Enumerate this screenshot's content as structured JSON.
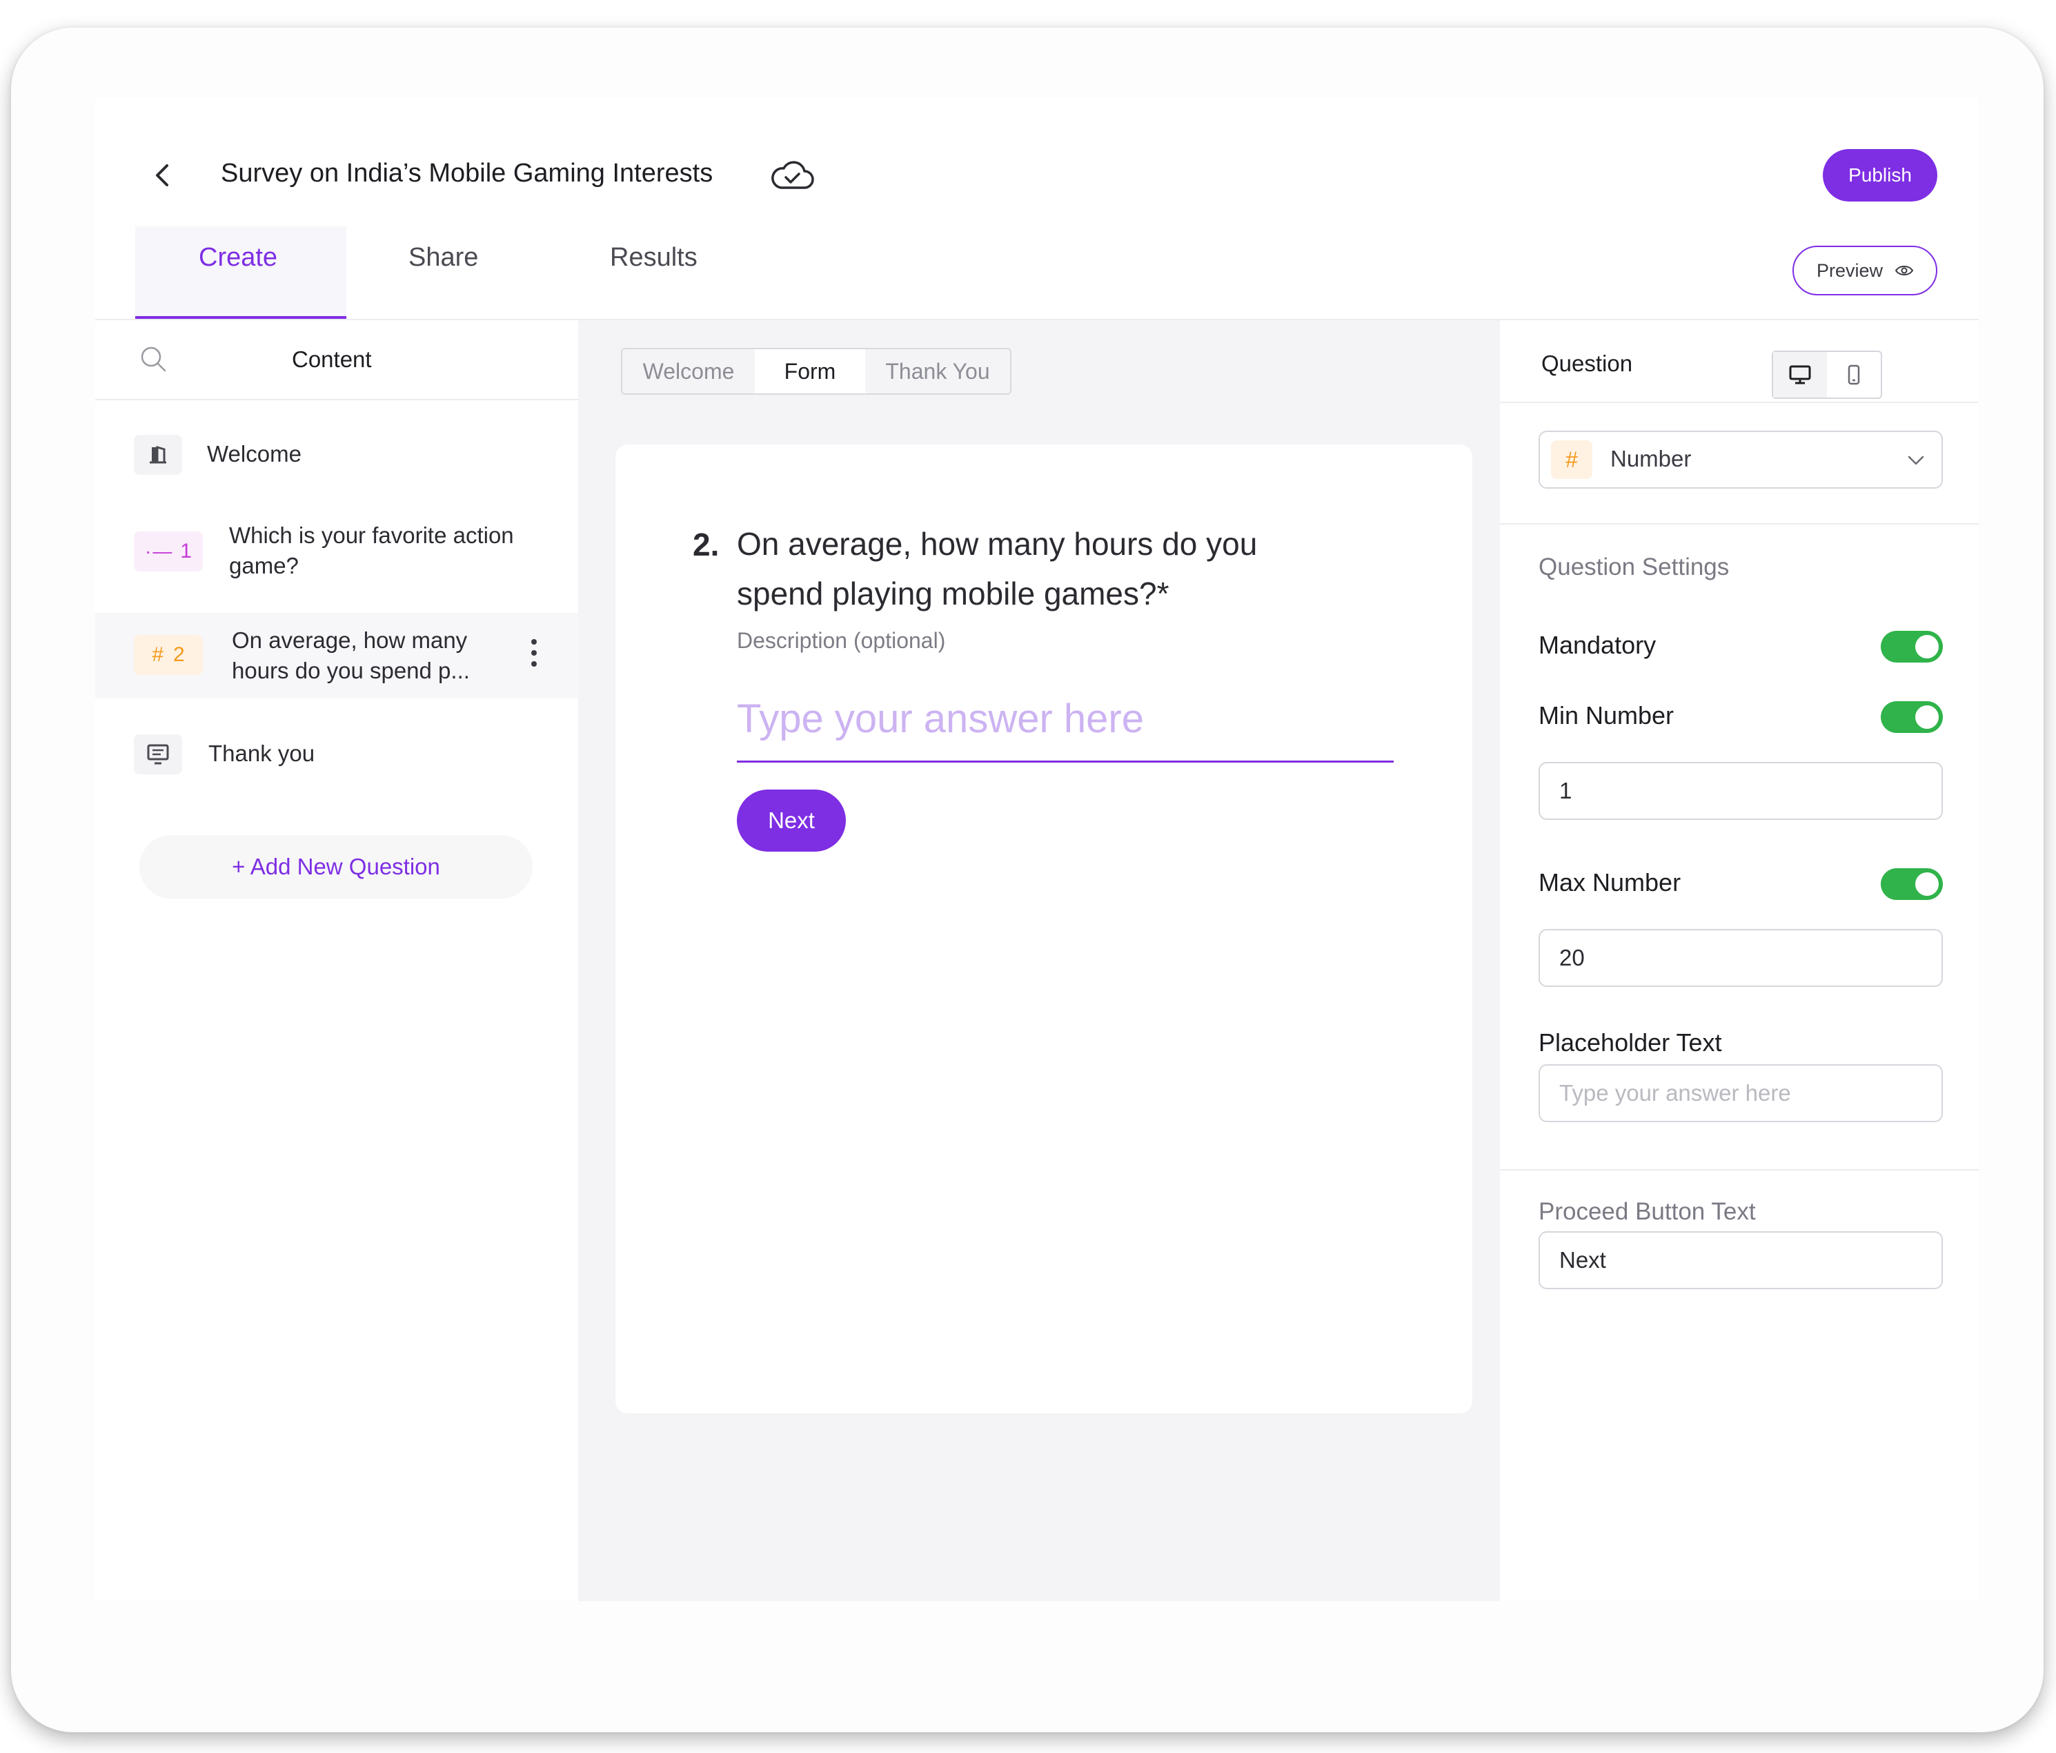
{
  "header": {
    "title": "Survey on India’s Mobile Gaming Interests",
    "publish_label": "Publish",
    "preview_label": "Preview"
  },
  "tabs": [
    {
      "label": "Create",
      "active": true
    },
    {
      "label": "Share",
      "active": false
    },
    {
      "label": "Results",
      "active": false
    }
  ],
  "sidebar": {
    "content_label": "Content",
    "items": [
      {
        "label": "Welcome",
        "icon": "door-icon"
      },
      {
        "number": "1",
        "label": "Which is your favorite action game?",
        "icon": "list-icon"
      },
      {
        "number": "2",
        "label": "On average, how many hours do you spend p...",
        "icon": "hash-icon",
        "active": true
      },
      {
        "label": "Thank you",
        "icon": "monitor-icon"
      }
    ],
    "add_question_label": "+ Add New Question"
  },
  "editor": {
    "segments": [
      "Welcome",
      "Form",
      "Thank You"
    ],
    "selected_segment": "Form",
    "question_number": "2.",
    "question_text": "On average, how many hours do you spend playing mobile games?*",
    "description_placeholder": "Description (optional)",
    "answer_placeholder": "Type your answer here",
    "next_label": "Next"
  },
  "settings": {
    "panel_title": "Question",
    "question_type": "Number",
    "section_title": "Question Settings",
    "mandatory_label": "Mandatory",
    "mandatory_on": true,
    "min_label": "Min Number",
    "min_on": true,
    "min_value": "1",
    "max_label": "Max Number",
    "max_on": true,
    "max_value": "20",
    "placeholder_label": "Placeholder Text",
    "placeholder_value": "Type your answer here",
    "proceed_section_title": "Proceed Button Text",
    "proceed_value": "Next"
  },
  "colors": {
    "accent": "#7e2ee3",
    "toggle_on": "#2fb34a",
    "number_badge": "#f39a1c",
    "list_badge": "#c43bd6"
  }
}
